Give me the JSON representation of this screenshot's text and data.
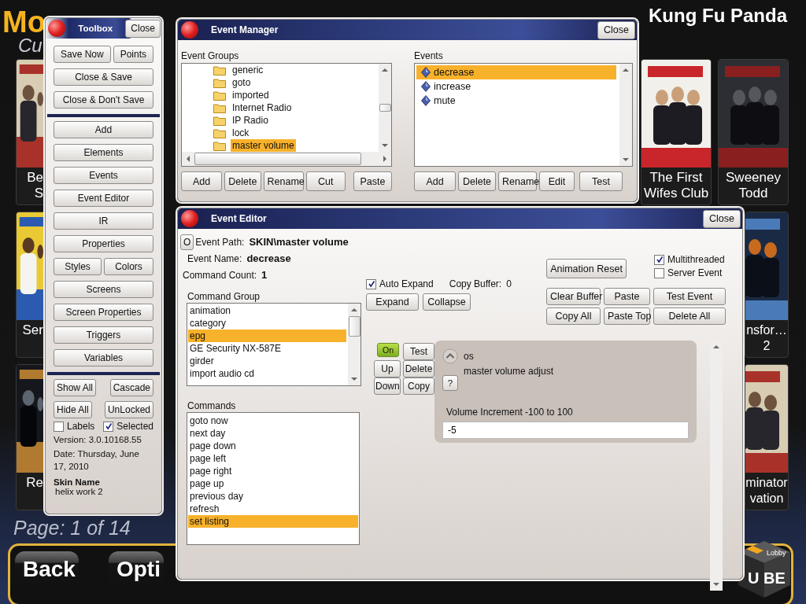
{
  "background": {
    "heading": "Mo",
    "subheading": "Cu",
    "now_playing": "Kung Fu Panda",
    "poster_rows": [
      {
        "left": {
          "title": [
            "Be",
            "S"
          ]
        },
        "right": [
          {
            "kind": "full",
            "title": [
              "The First",
              "Wifes Club"
            ]
          },
          {
            "kind": "full",
            "title": [
              "Sweeney",
              "Todd"
            ]
          }
        ]
      },
      {
        "left": {
          "title": [
            "Ser"
          ]
        },
        "right": [
          {
            "kind": "partial",
            "title": [
              "nsfor…",
              "2"
            ]
          }
        ]
      },
      {
        "left": {
          "title": [
            "Re"
          ]
        },
        "right": [
          {
            "kind": "partial",
            "title": [
              "minator",
              "vation"
            ]
          }
        ]
      }
    ],
    "page": "Page: 1 of 14",
    "nav_buttons": [
      "Back",
      "Opti"
    ],
    "logo": {
      "small": "Lobby",
      "big": "U BE"
    }
  },
  "toolbox": {
    "title": "Toolbox",
    "close": "Close",
    "command_groups": [
      [
        [
          "Save Now",
          "Points"
        ],
        [
          "Close & Save"
        ],
        [
          "Close & Don't Save"
        ]
      ],
      [
        [
          "Add"
        ],
        [
          "Elements"
        ],
        [
          "Events"
        ],
        [
          "Event Editor"
        ],
        [
          "IR"
        ],
        [
          "Properties"
        ],
        [
          "Styles",
          "Colors"
        ],
        [
          "Screens"
        ],
        [
          "Screen Properties"
        ],
        [
          "Triggers"
        ],
        [
          "Variables"
        ]
      ]
    ],
    "view_buttons": [
      [
        "Show All",
        "Cascade"
      ],
      [
        "Hide All",
        "UnLocked"
      ]
    ],
    "checkboxes": [
      {
        "label": "Labels",
        "checked": false
      },
      {
        "label": "Selected",
        "checked": true
      }
    ],
    "version": "Version: 3.0.10168.55",
    "date": "Date: Thursday, June 17, 2010",
    "skin_name_label": "Skin Name",
    "skin_name": "helix work 2"
  },
  "event_manager": {
    "title": "Event Manager",
    "close": "Close",
    "groups": {
      "label": "Event Groups",
      "items": [
        {
          "label": "generic",
          "selected": false
        },
        {
          "label": "goto",
          "selected": false
        },
        {
          "label": "imported",
          "selected": false
        },
        {
          "label": "Internet Radio",
          "selected": false
        },
        {
          "label": "IP Radio",
          "selected": false
        },
        {
          "label": "lock",
          "selected": false
        },
        {
          "label": "master volume",
          "selected": true
        }
      ],
      "buttons": [
        "Add",
        "Delete",
        "Rename",
        "Cut",
        "Paste"
      ]
    },
    "events": {
      "label": "Events",
      "items": [
        {
          "label": "decrease",
          "selected": true
        },
        {
          "label": "increase",
          "selected": false
        },
        {
          "label": "mute",
          "selected": false
        }
      ],
      "buttons": [
        "Add",
        "Delete",
        "Rename",
        "Edit",
        "Test"
      ]
    }
  },
  "event_editor": {
    "title": "Event Editor",
    "close": "Close",
    "open_button": "O",
    "path_label": "Event Path:",
    "path": "SKIN\\master volume",
    "name_label": "Event Name:",
    "name": "decrease",
    "count_label": "Command Count:",
    "count": "1",
    "auto_expand": {
      "label": "Auto Expand",
      "checked": true
    },
    "copy_buffer_label": "Copy Buffer:",
    "copy_buffer": "0",
    "expand_buttons": [
      "Expand",
      "Collapse"
    ],
    "animation_reset": "Animation Reset",
    "options": [
      {
        "label": "Multithreaded",
        "checked": true
      },
      {
        "label": "Server Event",
        "checked": false
      }
    ],
    "buffer_buttons": [
      [
        "Clear Buffer",
        "Paste",
        "Test Event"
      ],
      [
        "Copy All",
        "Paste Top",
        "Delete All"
      ]
    ],
    "command_group": {
      "label": "Command Group",
      "items": [
        {
          "label": "animation",
          "selected": false
        },
        {
          "label": "category",
          "selected": false
        },
        {
          "label": "epg",
          "selected": true
        },
        {
          "label": "GE Security NX-587E",
          "selected": false
        },
        {
          "label": "girder",
          "selected": false
        },
        {
          "label": "import audio cd",
          "selected": false
        }
      ]
    },
    "commands": {
      "label": "Commands",
      "items": [
        {
          "label": "goto now",
          "selected": false
        },
        {
          "label": "next day",
          "selected": false
        },
        {
          "label": "page down",
          "selected": false
        },
        {
          "label": "page left",
          "selected": false
        },
        {
          "label": "page right",
          "selected": false
        },
        {
          "label": "page up",
          "selected": false
        },
        {
          "label": "previous day",
          "selected": false
        },
        {
          "label": "refresh",
          "selected": false
        },
        {
          "label": "set listing",
          "selected": true
        }
      ]
    },
    "command_cards": [
      {
        "enabled": true,
        "on_label": "On",
        "actions": [
          "Test",
          "Up",
          "Delete",
          "Down",
          "Copy"
        ],
        "group": "os",
        "name": "master volume adjust",
        "help": "?",
        "param_label": "Volume Increment -100 to 100",
        "value": "-5"
      }
    ]
  }
}
